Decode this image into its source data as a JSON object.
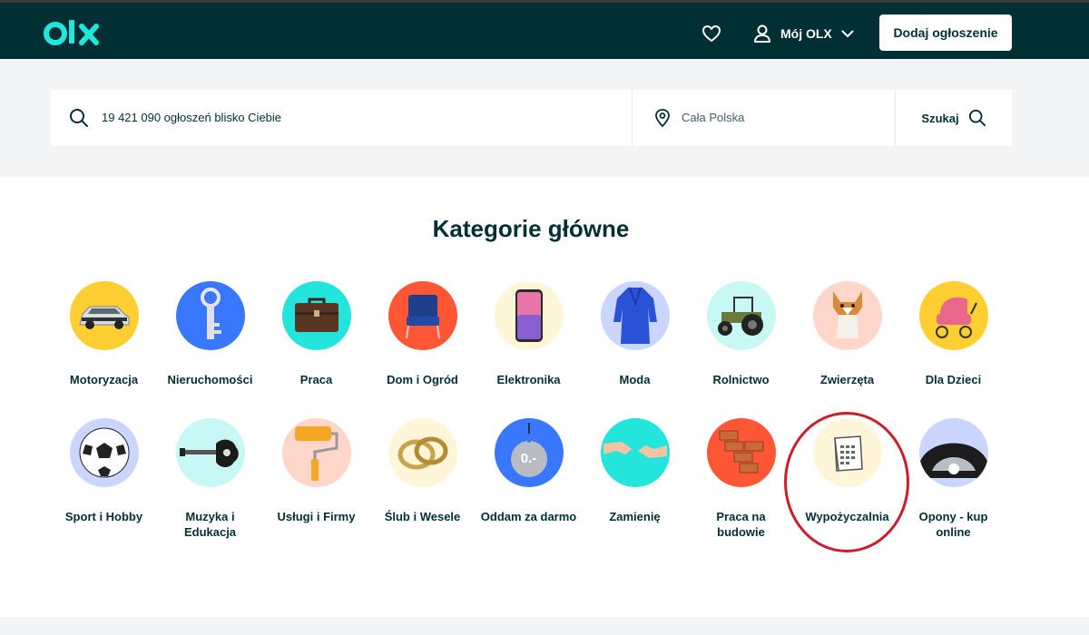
{
  "header": {
    "logo_text": "olx",
    "account_label": "Mój OLX",
    "add_button": "Dodaj ogłoszenie"
  },
  "search": {
    "query_value": "19 421 090 ogłoszeń blisko Ciebie",
    "location_value": "Cała Polska",
    "submit_label": "Szukaj"
  },
  "categories": {
    "title": "Kategorie główne",
    "items": [
      {
        "label": "Motoryzacja",
        "bg": "#ffce32"
      },
      {
        "label": "Nieruchomości",
        "bg": "#3a77ff"
      },
      {
        "label": "Praca",
        "bg": "#23e5db"
      },
      {
        "label": "Dom i Ogród",
        "bg": "#ff5636"
      },
      {
        "label": "Elektronika",
        "bg": "#fff6d9"
      },
      {
        "label": "Moda",
        "bg": "#cad6ff"
      },
      {
        "label": "Rolnictwo",
        "bg": "#c8f8f6"
      },
      {
        "label": "Zwierzęta",
        "bg": "#ffd6c9"
      },
      {
        "label": "Dla Dzieci",
        "bg": "#ffce32"
      },
      {
        "label": "Sport i Hobby",
        "bg": "#cad6ff"
      },
      {
        "label": "Muzyka i Edukacja",
        "bg": "#c8f8f6"
      },
      {
        "label": "Usługi i Firmy",
        "bg": "#ffd6c9"
      },
      {
        "label": "Ślub i Wesele",
        "bg": "#fff6d9"
      },
      {
        "label": "Oddam za darmo",
        "bg": "#3a77ff",
        "tag_text": "0.-"
      },
      {
        "label": "Zamienię",
        "bg": "#23e5db"
      },
      {
        "label": "Praca na budowie",
        "bg": "#ff5636"
      },
      {
        "label": "Wypożyczalnia",
        "bg": "#fff6d9"
      },
      {
        "label": "Opony - kup online",
        "bg": "#cad6ff"
      }
    ]
  },
  "colors": {
    "brand_dark": "#002f34",
    "brand_teal": "#23e5db",
    "band_gray": "#f2f4f5",
    "highlight_ring": "#cc1d2a"
  },
  "icons": {
    "logo": "olx-logo",
    "favorites": "heart-icon",
    "account": "user-icon",
    "account_menu": "chevron-down-icon",
    "search": "search-icon",
    "location": "location-pin-icon"
  }
}
